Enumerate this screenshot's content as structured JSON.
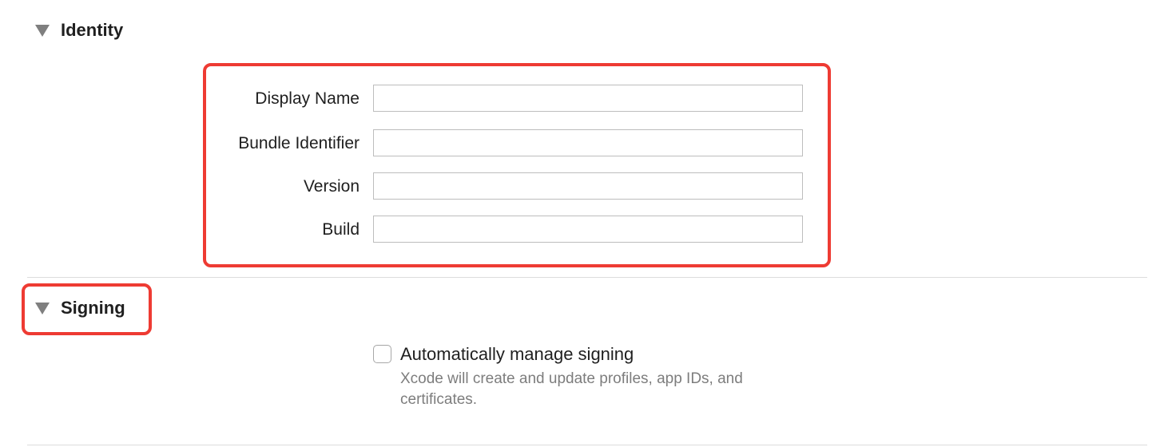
{
  "identity": {
    "title": "Identity",
    "fields": [
      {
        "label": "Display Name",
        "value": "",
        "placeholder": ""
      },
      {
        "label": "Bundle Identifier",
        "value": "",
        "placeholder": ""
      },
      {
        "label": "Version",
        "value": "",
        "placeholder": ""
      },
      {
        "label": "Build",
        "value": "",
        "placeholder": ""
      }
    ]
  },
  "signing": {
    "title": "Signing",
    "auto_manage": {
      "label": "Automatically manage signing",
      "checked": false,
      "help_line1": "Xcode will create and update profiles, app IDs, and",
      "help_line2": "certificates."
    }
  },
  "colors": {
    "highlight": "#ee3b33",
    "disclosure": "#7f7f7f",
    "help_text": "#7d7d7d",
    "divider": "#dcdcdc"
  }
}
